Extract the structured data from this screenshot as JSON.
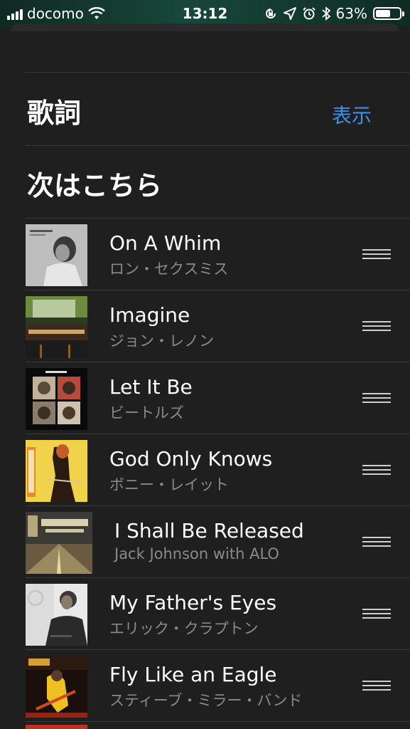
{
  "status_bar": {
    "carrier": "docomo",
    "time": "13:12",
    "battery": "63%",
    "battery_level": 0.63
  },
  "lyrics": {
    "heading": "歌詞",
    "action": "表示"
  },
  "up_next": {
    "heading": "次はこちら"
  },
  "queue": [
    {
      "title": "On A Whim",
      "artist": "ロン・セクスミス"
    },
    {
      "title": "Imagine",
      "artist": "ジョン・レノン"
    },
    {
      "title": "Let It Be",
      "artist": "ビートルズ"
    },
    {
      "title": "God Only Knows",
      "artist": "ボニー・レイット"
    },
    {
      "title": "I Shall Be Released",
      "artist": "Jack Johnson with ALO"
    },
    {
      "title": "My Father's Eyes",
      "artist": "エリック・クラプトン"
    },
    {
      "title": "Fly Like an Eagle",
      "artist": "スティーブ・ミラー・バンド"
    }
  ],
  "icons": [
    "cellular-signal-icon",
    "wifi-icon",
    "screen-rotation-lock-icon",
    "location-icon",
    "alarm-icon",
    "bluetooth-icon",
    "battery-icon",
    "reorder-handle-icon"
  ],
  "colors": {
    "accent": "#3d8fe6",
    "background": "#1f1f1f",
    "secondary_text": "#8a8a8a"
  }
}
